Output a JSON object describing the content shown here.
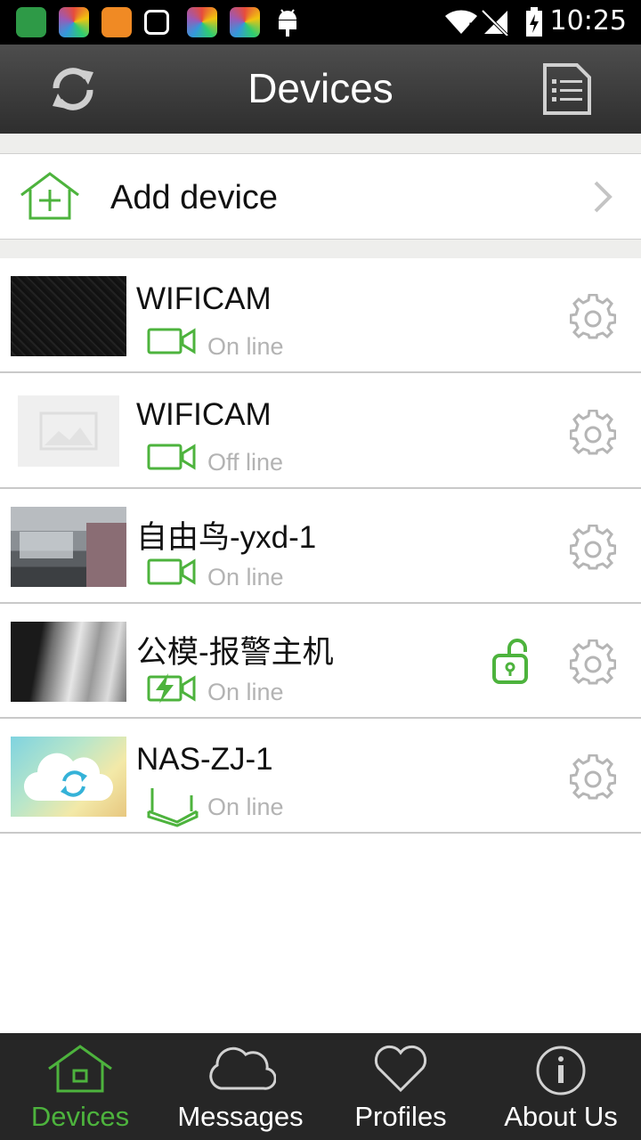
{
  "status_bar": {
    "time": "10:25"
  },
  "header": {
    "title": "Devices"
  },
  "add_device": {
    "label": "Add device"
  },
  "devices": [
    {
      "name": "WIFICAM",
      "status": "On line",
      "type": "camera",
      "thumb": "night-camera"
    },
    {
      "name": "WIFICAM",
      "status": "Off line",
      "type": "camera",
      "thumb": "placeholder"
    },
    {
      "name": "自由鸟-yxd-1",
      "status": "On line",
      "type": "camera",
      "thumb": "office"
    },
    {
      "name": "公模-报警主机",
      "status": "On line",
      "type": "alarm-camera",
      "thumb": "grey",
      "lock": true
    },
    {
      "name": "NAS-ZJ-1",
      "status": "On line",
      "type": "router",
      "thumb": "cloud"
    }
  ],
  "tabs": [
    {
      "label": "Devices",
      "icon": "home-icon",
      "active": true
    },
    {
      "label": "Messages",
      "icon": "cloud-icon",
      "active": false
    },
    {
      "label": "Profiles",
      "icon": "heart-icon",
      "active": false
    },
    {
      "label": "About Us",
      "icon": "info-icon",
      "active": false
    }
  ],
  "colors": {
    "accent": "#4db33d",
    "titlebar": "#3a3a3a",
    "tabbar": "#262626"
  }
}
